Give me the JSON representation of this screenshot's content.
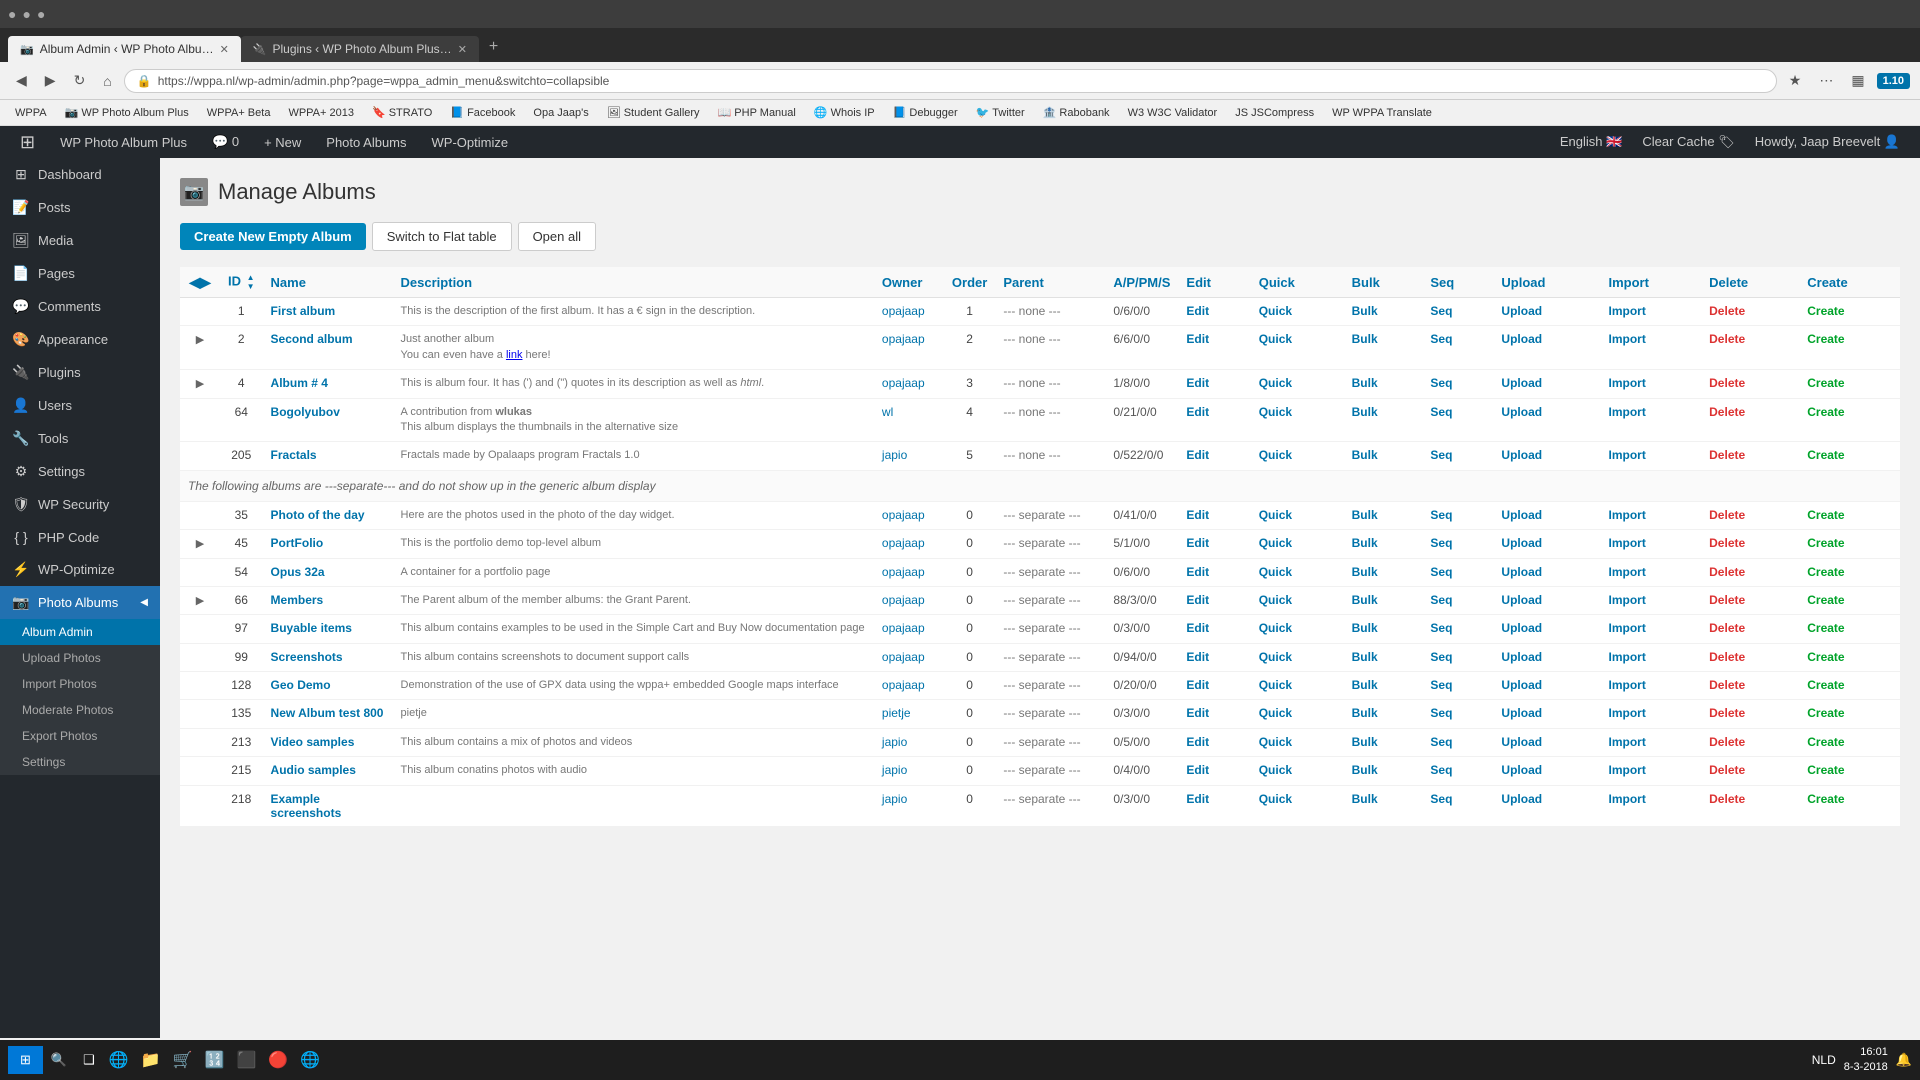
{
  "browser": {
    "tabs": [
      {
        "id": "tab1",
        "title": "Album Admin ‹ WP Photo Albu…",
        "active": true,
        "favicon": "📷"
      },
      {
        "id": "tab2",
        "title": "Plugins ‹ WP Photo Album Plus…",
        "active": false,
        "favicon": "🔌"
      }
    ],
    "address": "https://wppa.nl/wp-admin/admin.php?page=wppa_admin_menu&switchto=collapsible",
    "bookmarks": [
      "WPPA",
      "WP Photo Album Plus",
      "WPPA+ Beta",
      "WPPA+ 2013",
      "STRATO",
      "Facebook",
      "Opa Jaap's",
      "Student Gallery",
      "PHP Manual",
      "Whois IP",
      "Debugger",
      "Twitter",
      "Rabobank",
      "W3C Validator",
      "JSCompress",
      "WPPA Translate"
    ]
  },
  "adminBar": {
    "left": [
      "WPPA",
      "WP Photo Album Plus",
      "0",
      "New",
      "Photo Albums",
      "WP-Optimize"
    ],
    "right": [
      "English",
      "Clear Cache",
      "Howdy, Jaap Breevelt"
    ]
  },
  "sidebar": {
    "items": [
      {
        "id": "dashboard",
        "label": "Dashboard",
        "icon": "⊞"
      },
      {
        "id": "posts",
        "label": "Posts",
        "icon": "📝"
      },
      {
        "id": "media",
        "label": "Media",
        "icon": "🖼"
      },
      {
        "id": "pages",
        "label": "Pages",
        "icon": "📄"
      },
      {
        "id": "comments",
        "label": "Comments",
        "icon": "💬"
      },
      {
        "id": "appearance",
        "label": "Appearance",
        "icon": "🎨"
      },
      {
        "id": "plugins",
        "label": "Plugins",
        "icon": "🔌"
      },
      {
        "id": "users",
        "label": "Users",
        "icon": "👤"
      },
      {
        "id": "tools",
        "label": "Tools",
        "icon": "🔧"
      },
      {
        "id": "settings",
        "label": "Settings",
        "icon": "⚙"
      },
      {
        "id": "wpsecurity",
        "label": "WP Security",
        "icon": "🛡"
      },
      {
        "id": "phpcode",
        "label": "PHP Code",
        "icon": "{ }"
      },
      {
        "id": "wpoptimize",
        "label": "WP-Optimize",
        "icon": "⚡"
      },
      {
        "id": "photoalbums",
        "label": "Photo Albums",
        "icon": "📷",
        "active": true
      }
    ],
    "subItems": [
      {
        "id": "albumadmin",
        "label": "Album Admin",
        "active": true
      },
      {
        "id": "uploadphotos",
        "label": "Upload Photos"
      },
      {
        "id": "importphotos",
        "label": "Import Photos"
      },
      {
        "id": "moderatephotos",
        "label": "Moderate Photos"
      },
      {
        "id": "exportphotos",
        "label": "Export Photos"
      },
      {
        "id": "settings-sub",
        "label": "Settings"
      }
    ]
  },
  "page": {
    "title": "Manage Albums",
    "buttons": {
      "createNew": "Create New Empty Album",
      "switchFlat": "Switch to Flat table",
      "openAll": "Open all"
    }
  },
  "table": {
    "headers": {
      "toggle": "◀▶",
      "id": "ID",
      "name": "Name",
      "description": "Description",
      "owner": "Owner",
      "order": "Order",
      "parent": "Parent",
      "apms": "A/P/PM/S",
      "edit": "Edit",
      "quick": "Quick",
      "bulk": "Bulk",
      "seq": "Seq",
      "upload": "Upload",
      "import": "Import",
      "delete": "Delete",
      "create": "Create"
    },
    "mainAlbums": [
      {
        "id": "1",
        "expand": false,
        "name": "First album",
        "description": "This is the description of the first album. It has a € sign in the description.",
        "owner": "opajaap",
        "order": "1",
        "parent": "--- none ---",
        "apms": "0/6/0/0"
      },
      {
        "id": "2",
        "expand": true,
        "name": "Second album",
        "description": "Just another album<br /> You can even have a <a href=\"http://www.wppa.nl\">link</a> here!",
        "owner": "opajaap",
        "order": "2",
        "parent": "--- none ---",
        "apms": "6/6/0/0"
      },
      {
        "id": "4",
        "expand": true,
        "name": "Album # 4",
        "description": "This is album four. It has (') and (\") quotes in its description as well as <i>html</i>.",
        "owner": "opajaap",
        "order": "3",
        "parent": "--- none ---",
        "apms": "1/8/0/0"
      },
      {
        "id": "64",
        "expand": false,
        "name": "Bogolyubov",
        "description": "A contribution from <strong>wlukas</strong> <br /> This album displays the thumbnails in the alternative size",
        "owner": "wl",
        "order": "4",
        "parent": "--- none ---",
        "apms": "0/21/0/0"
      },
      {
        "id": "205",
        "expand": false,
        "name": "Fractals",
        "description": "Fractals made by Opalaaps program Fractals 1.0",
        "owner": "japio",
        "order": "5",
        "parent": "--- none ---",
        "apms": "0/522/0/0"
      }
    ],
    "separatorText": "The following albums are ---separate--- and do not show up in the generic album display",
    "separateAlbums": [
      {
        "id": "35",
        "expand": false,
        "name": "Photo of the day",
        "description": "Here are the photos used in the photo of the day widget.",
        "owner": "opajaap",
        "order": "0",
        "parent": "--- separate ---",
        "apms": "0/41/0/0"
      },
      {
        "id": "45",
        "expand": true,
        "name": "PortFolio",
        "description": "This is the portfolio demo top-level album",
        "owner": "opajaap",
        "order": "0",
        "parent": "--- separate ---",
        "apms": "5/1/0/0"
      },
      {
        "id": "54",
        "expand": false,
        "name": "Opus 32a",
        "description": "A container for a portfolio page",
        "owner": "opajaap",
        "order": "0",
        "parent": "--- separate ---",
        "apms": "0/6/0/0"
      },
      {
        "id": "66",
        "expand": true,
        "name": "Members",
        "description": "The Parent album of the member albums: the Grant Parent.",
        "owner": "opajaap",
        "order": "0",
        "parent": "--- separate ---",
        "apms": "88/3/0/0"
      },
      {
        "id": "97",
        "expand": false,
        "name": "Buyable items",
        "description": "This album contains examples to be used in the Simple Cart and Buy Now documentation page",
        "owner": "opajaap",
        "order": "0",
        "parent": "--- separate ---",
        "apms": "0/3/0/0"
      },
      {
        "id": "99",
        "expand": false,
        "name": "Screenshots",
        "description": "This album contains screenshots to document support calls",
        "owner": "opajaap",
        "order": "0",
        "parent": "--- separate ---",
        "apms": "0/94/0/0"
      },
      {
        "id": "128",
        "expand": false,
        "name": "Geo Demo",
        "description": "Demonstration of the use of GPX data using the wppa+ embedded Google maps interface",
        "owner": "opajaap",
        "order": "0",
        "parent": "--- separate ---",
        "apms": "0/20/0/0"
      },
      {
        "id": "135",
        "expand": false,
        "name": "New Album test 800",
        "description": "pietje",
        "owner": "pietje",
        "order": "0",
        "parent": "--- separate ---",
        "apms": "0/3/0/0"
      },
      {
        "id": "213",
        "expand": false,
        "name": "Video samples",
        "description": "This album contains a mix of photos and videos",
        "owner": "japio",
        "order": "0",
        "parent": "--- separate ---",
        "apms": "0/5/0/0"
      },
      {
        "id": "215",
        "expand": false,
        "name": "Audio samples",
        "description": "This album conatins photos with audio",
        "owner": "japio",
        "order": "0",
        "parent": "--- separate ---",
        "apms": "0/4/0/0"
      },
      {
        "id": "218",
        "expand": false,
        "name": "Example screenshots",
        "description": "",
        "owner": "japio",
        "order": "0",
        "parent": "--- separate ---",
        "apms": "0/3/0/0"
      }
    ],
    "actions": [
      "Edit",
      "Quick",
      "Bulk",
      "Seq",
      "Upload",
      "Import",
      "Delete",
      "Create"
    ]
  },
  "taskbar": {
    "time": "16:01",
    "date": "8-3-2018",
    "language": "NLD"
  }
}
